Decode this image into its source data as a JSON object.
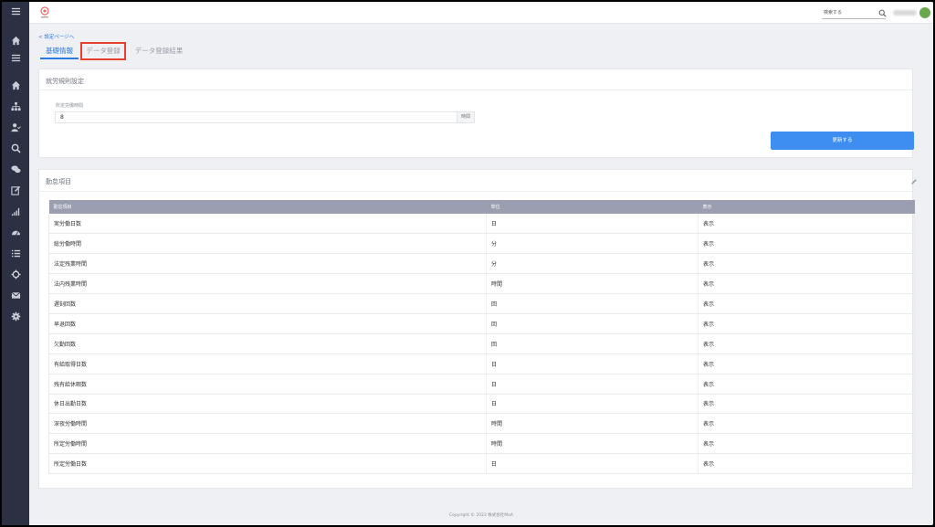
{
  "header": {
    "search_placeholder": "検索する",
    "icons": [
      "logo-icon",
      "search-icon",
      "avatar"
    ]
  },
  "sidebar": {
    "icons": [
      "menu-icon",
      "home-icon",
      "list-icon",
      "home-icon",
      "org-chart-icon",
      "user-check-icon",
      "search-icon",
      "chat-icon",
      "edit-icon",
      "signal-icon",
      "gauge-icon",
      "list-icon",
      "crosshair-icon",
      "mail-icon",
      "gear-icon"
    ]
  },
  "nav": {
    "back_link": "< 設定ページへ",
    "tabs": [
      {
        "label": "基礎情報",
        "active": true
      },
      {
        "label": "データ登録",
        "active": false
      },
      {
        "label": "データ登録結果",
        "active": false
      }
    ]
  },
  "work_rules": {
    "title": "就労規則設定",
    "field_label": "所定労働時間",
    "field_value": "8",
    "field_unit": "時間",
    "update_button": "更新する"
  },
  "attendance": {
    "title": "勤怠項目",
    "columns": [
      "勤怠項目",
      "単位",
      "表示"
    ],
    "rows": [
      [
        "実労働日数",
        "日",
        "表示"
      ],
      [
        "総労働時間",
        "分",
        "表示"
      ],
      [
        "法定残業時間",
        "分",
        "表示"
      ],
      [
        "法内残業時間",
        "時間",
        "表示"
      ],
      [
        "遅刻回数",
        "回",
        "表示"
      ],
      [
        "早退回数",
        "回",
        "表示"
      ],
      [
        "欠勤回数",
        "回",
        "表示"
      ],
      [
        "有給取得日数",
        "日",
        "表示"
      ],
      [
        "残有給休暇数",
        "日",
        "表示"
      ],
      [
        "休日出勤日数",
        "日",
        "表示"
      ],
      [
        "深夜労働時間",
        "時間",
        "表示"
      ],
      [
        "所定労働時間",
        "時間",
        "表示"
      ],
      [
        "所定労働日数",
        "日",
        "表示"
      ]
    ]
  },
  "footer": {
    "copyright": "Copyright © 2022 株式会社MoA"
  },
  "colors": {
    "accent": "#2d7ae0",
    "button": "#3d8ef0",
    "sidebar": "#2b3142",
    "highlight": "#e8402e",
    "table_header": "#9a9eb0"
  }
}
